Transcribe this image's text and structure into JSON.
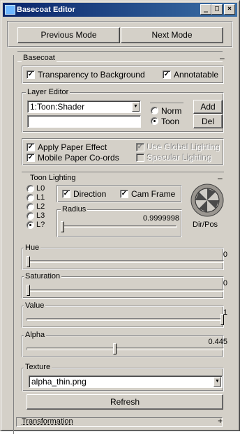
{
  "window": {
    "title": "Basecoat Editor",
    "minimize": "_",
    "maximize": "□",
    "close": "×"
  },
  "modes": {
    "previous": "Previous Mode",
    "next": "Next Mode"
  },
  "basecoat": {
    "title": "Basecoat",
    "collapse": "–",
    "transparency_label": "Transparency to Background",
    "transparency_checked": true,
    "annotatable_label": "Annotatable",
    "annotatable_checked": true
  },
  "layer_editor": {
    "title": "Layer Editor",
    "selected_layer": "1:Toon:Shader",
    "name_value": "",
    "norm_label": "Norm",
    "toon_label": "Toon",
    "selected_mode": "Toon",
    "add_label": "Add",
    "del_label": "Del"
  },
  "paper": {
    "apply_label": "Apply Paper Effect",
    "mobile_label": "Mobile Paper Co-ords",
    "global_label": "Use Global Lighting",
    "specular_label": "Specular Lighting"
  },
  "toon_lighting": {
    "title": "Toon Lighting",
    "collapse": "–",
    "lights": [
      "L0",
      "L1",
      "L2",
      "L3",
      "L?"
    ],
    "selected_light": "L?",
    "direction_label": "Direction",
    "cam_frame_label": "Cam Frame",
    "radius_label": "Radius",
    "radius_value": "0.9999998",
    "radius_fraction": 0.0,
    "dirpos_label": "Dir/Pos"
  },
  "sliders": [
    {
      "label": "Hue",
      "value": "0",
      "fraction": 0.0
    },
    {
      "label": "Saturation",
      "value": "0",
      "fraction": 0.0
    },
    {
      "label": "Value",
      "value": "1",
      "fraction": 1.0
    },
    {
      "label": "Alpha",
      "value": "0.445",
      "fraction": 0.445
    }
  ],
  "texture": {
    "title": "Texture",
    "value": "alpha_thin.png"
  },
  "refresh_label": "Refresh",
  "transformation": {
    "title": "Transformation",
    "expand": "+"
  }
}
